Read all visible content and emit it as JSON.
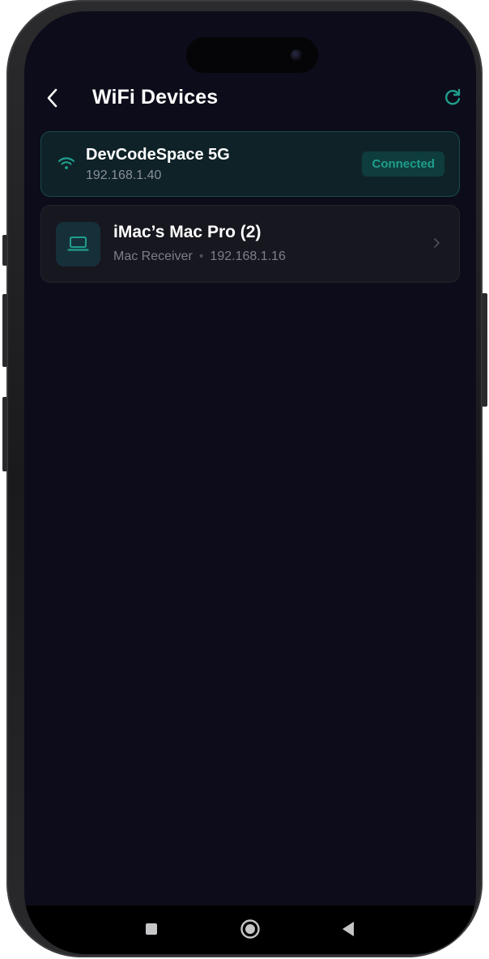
{
  "header": {
    "title": "WiFi Devices",
    "back_icon": "chevron-left-icon",
    "refresh_icon": "refresh-icon"
  },
  "connected_network": {
    "name": "DevCodeSpace 5G",
    "ip": "192.168.1.40",
    "status": "Connected",
    "icon": "wifi-icon"
  },
  "devices": [
    {
      "name": "iMac’s Mac Pro (2)",
      "type": "Mac Receiver",
      "separator": "•",
      "ip": "192.168.1.16",
      "icon": "laptop-icon"
    }
  ],
  "navbar": {
    "items": [
      "recents-icon",
      "home-icon",
      "back-icon"
    ]
  },
  "colors": {
    "background": "#0c0c1a",
    "accent": "#1f9e8c",
    "card": "#17171f",
    "connected_card": "#0e2228"
  }
}
